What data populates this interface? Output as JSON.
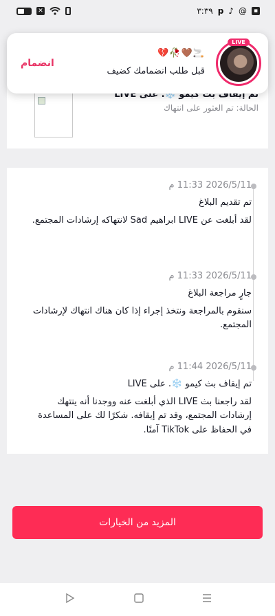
{
  "status_bar": {
    "time": "٣:٣٩",
    "right_icons": [
      "p-icon",
      "tiktok-icon",
      "threads-icon",
      "square-app-icon"
    ],
    "left_icons": [
      "battery-icon",
      "x-icon",
      "wifi-icon",
      "vibrate-icon"
    ]
  },
  "toast": {
    "live_badge": "LIVE",
    "name_emoji": "💔🥀🤎🚬",
    "message": "قبل طلب انضمامك كضيف",
    "join_label": "انضمام"
  },
  "report_card": {
    "title": "تم إيقاف بث كيمو ❄️. على LIVE",
    "status": "الحالة: تم العثور على انتهاك"
  },
  "timeline": [
    {
      "time": "2026/5/11 11:33 م",
      "heading": "تم تقديم البلاغ",
      "body": "لقد أبلغت عن LIVE ابراهيم Sad لانتهاكه إرشادات المجتمع."
    },
    {
      "time": "2026/5/11 11:33 م",
      "heading": "جارٍ مراجعة البلاغ",
      "body": "سنقوم بالمراجعة ونتخذ إجراء إذا كان هناك انتهاك لإرشادات المجتمع."
    },
    {
      "time": "2026/5/11 11:44 م",
      "heading": "تم إيقاف بث كيمو ❄️. على LIVE",
      "body": "لقد راجعنا بث LIVE الذي أبلغت عنه ووجدنا أنه ينتهك إرشادات المجتمع، وقد تم إيقافه. شكرًا لك على المساعدة في الحفاظ على TikTok آمنًا."
    }
  ],
  "more_options_label": "المزيد من الخيارات",
  "nav": {
    "back_icon": "triangle-back-icon",
    "home_icon": "square-home-icon",
    "menu_icon": "menu-icon"
  },
  "colors": {
    "accent": "#fe2c55",
    "join_text": "#e83465",
    "live_ring": "#ef2a6b"
  }
}
